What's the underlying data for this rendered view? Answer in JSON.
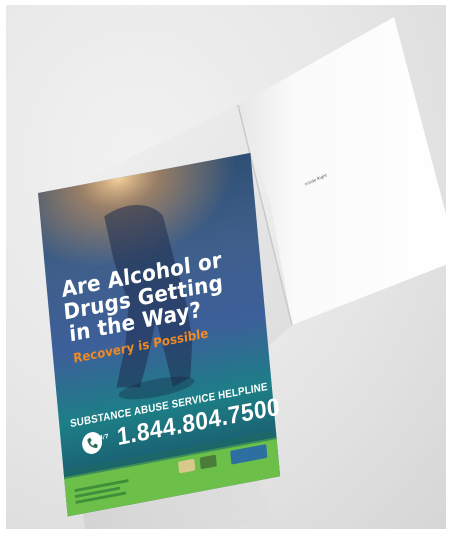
{
  "card": {
    "headline_line1": "Are Alcohol or",
    "headline_line2": "Drugs Getting",
    "headline_line3": "in the Way?",
    "subheadline": "Recovery is Possible",
    "helpline_label": "SUBSTANCE ABUSE SERVICE HELPLINE",
    "phone_number": "1.844.804.7500",
    "phone_badge_text": "24/7",
    "inside_text": "Inside Right"
  },
  "colors": {
    "background": "#e6e6e6",
    "brand_green": "#6cc04a",
    "accent_orange": "#f08a24",
    "cover_teal": "#1c7f86",
    "cover_blue": "#2a3f73"
  }
}
